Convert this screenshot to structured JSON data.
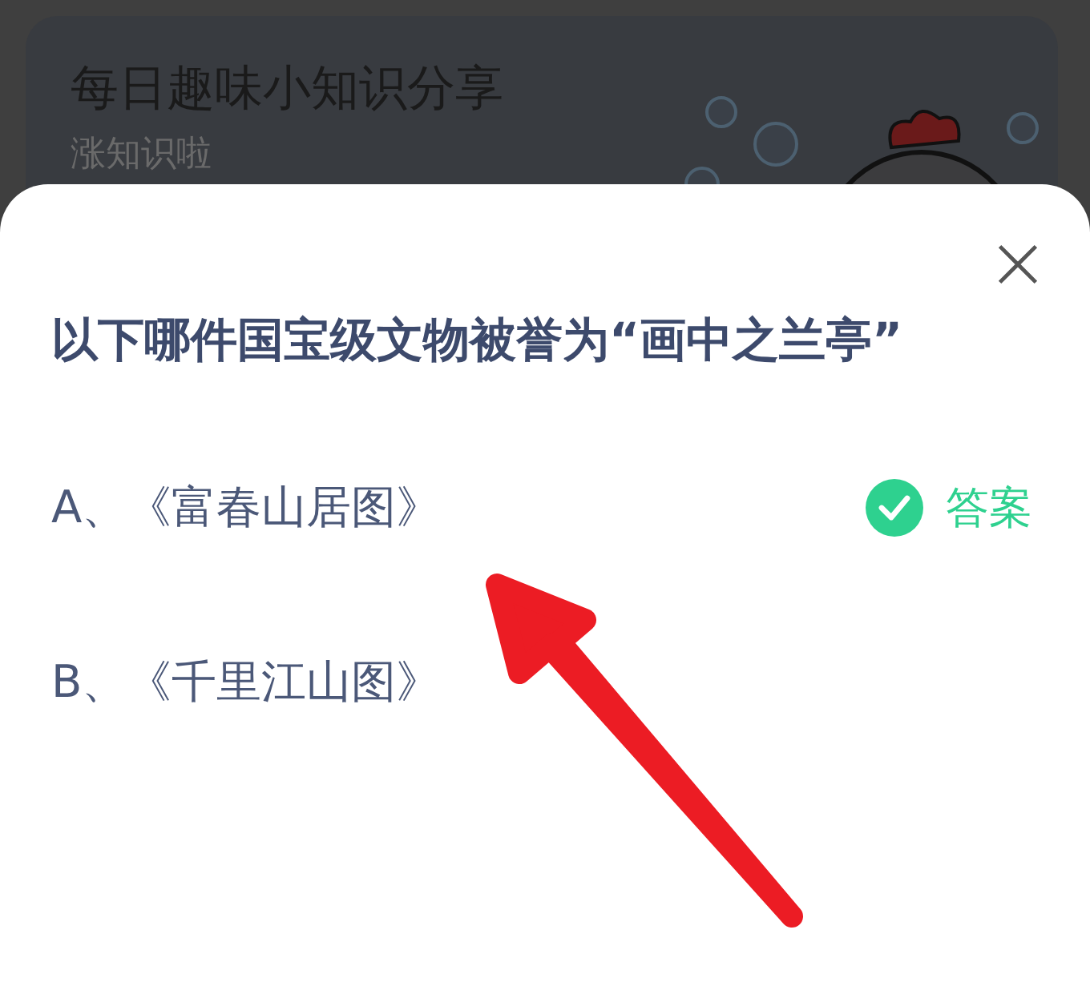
{
  "card": {
    "title": "每日趣味小知识分享",
    "subtitle": "涨知识啦"
  },
  "quiz": {
    "question": "以下哪件国宝级文物被誉为“画中之兰亭”",
    "answer_label": "答案",
    "options": [
      {
        "label": "A、《富春山居图》",
        "correct": true
      },
      {
        "label": "B、《千里江山图》",
        "correct": false
      }
    ]
  }
}
